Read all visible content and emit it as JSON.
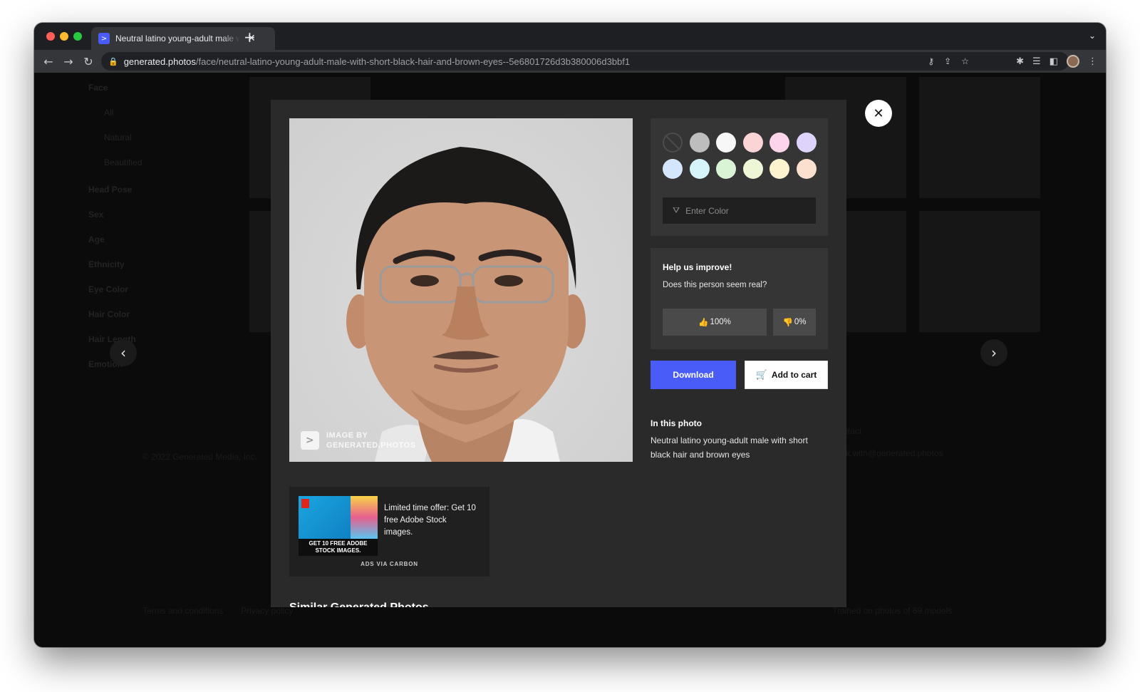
{
  "browser": {
    "tab_title": "Neutral latino young-adult male with short black hair and brown eyes",
    "favicon_glyph": ">",
    "url_host": "generated.photos",
    "url_path": "/face/neutral-latino-young-adult-male-with-short-black-hair-and-brown-eyes--5e6801726d3b380006d3bbf1"
  },
  "background_page": {
    "sidebar": [
      "Face",
      "All",
      "Natural",
      "Beautified",
      "Head Pose",
      "Sex",
      "Age",
      "Ethnicity",
      "Eye Color",
      "Hair Color",
      "Hair Length",
      "Emotion"
    ],
    "footer": {
      "copyright": "© 2022 Generated Media, Inc.",
      "terms": "Terms and conditions",
      "privacy": "Privacy policy",
      "contact_heading": "Contact",
      "contact_email": "work.with@generated.photos",
      "tagline": "Trained on photos of 69 models"
    }
  },
  "modal": {
    "watermark": [
      "IMAGE BY",
      "GENERATED.PHOTOS"
    ],
    "color_picker": {
      "swatches": [
        "none",
        "#bdbdbd",
        "#f7f7f7",
        "#fbd4d6",
        "#fcd5ea",
        "#ddd3fb",
        "#d3e6fb",
        "#d6f5fb",
        "#d9f3d5",
        "#edf7d5",
        "#fdf4cf",
        "#fbe0d0"
      ],
      "input_placeholder": "Enter Color"
    },
    "feedback": {
      "title": "Help us improve!",
      "question": "Does this person seem real?",
      "up_icon": "👍",
      "up_value": "100%",
      "down_icon": "👎",
      "down_value": "0%"
    },
    "download_label": "Download",
    "cart_label": "Add to cart",
    "info_title": "In this photo",
    "info_desc": "Neutral latino young-adult male with short black hair and brown eyes",
    "ad": {
      "image_caption": "GET 10 FREE ADOBE STOCK IMAGES.",
      "text": "Limited time offer: Get 10 free Adobe Stock images.",
      "via": "ADS VIA CARBON"
    },
    "similar_heading": "Similar Generated Photos"
  },
  "colors": {
    "accent": "#4a5cf7",
    "modal_bg": "#2a2a2b",
    "panel_bg": "#353536"
  }
}
